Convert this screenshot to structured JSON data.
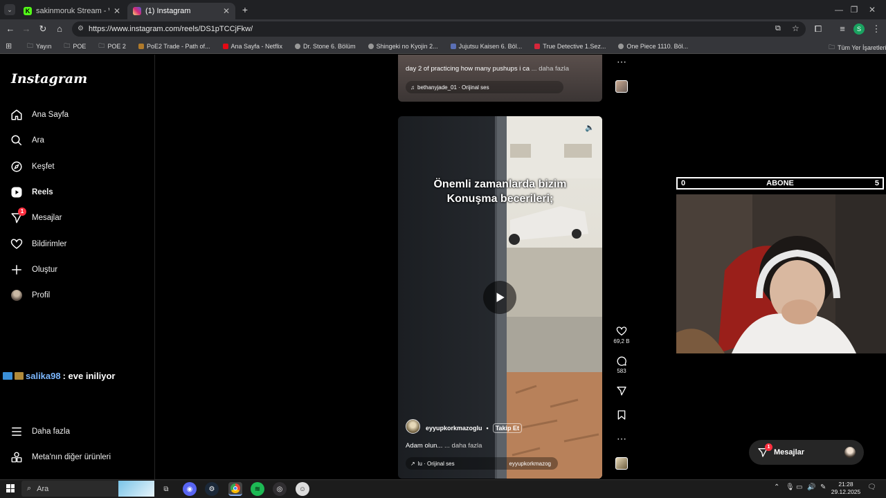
{
  "browser": {
    "tabs": [
      {
        "title": "sakinmoruk Stream - Watch Liv",
        "favicon_color": "#53fc18"
      },
      {
        "title": "(1) Instagram",
        "favicon_color": "#d62976"
      }
    ],
    "url": "https://www.instagram.com/reels/DS1pTCCjFkw/",
    "profile_initial": "S",
    "bookmarks": [
      {
        "label": "Yayın",
        "icon": "folder-icon"
      },
      {
        "label": "POE",
        "icon": "folder-icon"
      },
      {
        "label": "POE 2",
        "icon": "folder-icon"
      },
      {
        "label": "PoE2 Trade - Path of...",
        "icon": "poe-icon"
      },
      {
        "label": "Ana Sayfa - Netflix",
        "icon": "netflix-icon"
      },
      {
        "label": "Dr. Stone 6. Bölüm",
        "icon": "site-icon"
      },
      {
        "label": "Shingeki no Kyojin 2...",
        "icon": "site-icon"
      },
      {
        "label": "Jujutsu Kaisen 6. Böl...",
        "icon": "site-icon"
      },
      {
        "label": "True Detective 1.Sez...",
        "icon": "site-icon"
      },
      {
        "label": "One Piece 1110. Böl...",
        "icon": "site-icon"
      }
    ],
    "all_bookmarks": "Tüm Yer İşaretleri"
  },
  "instagram": {
    "logo": "Instagram",
    "nav": [
      {
        "label": "Ana Sayfa",
        "icon": "home-icon"
      },
      {
        "label": "Ara",
        "icon": "search-icon"
      },
      {
        "label": "Keşfet",
        "icon": "compass-icon"
      },
      {
        "label": "Reels",
        "icon": "reels-icon"
      },
      {
        "label": "Mesajlar",
        "icon": "messenger-icon",
        "badge": "1"
      },
      {
        "label": "Bildirimler",
        "icon": "heart-icon"
      },
      {
        "label": "Oluştur",
        "icon": "plus-icon"
      },
      {
        "label": "Profil",
        "icon": "avatar"
      }
    ],
    "more": "Daha fazla",
    "meta": "Meta'nın diğer ürünleri",
    "prev_reel": {
      "caption": "day 2 of practicing how many pushups i ca",
      "more": "... daha fazla",
      "audio": "bethanyjade_01 · Orijinal ses"
    },
    "reel": {
      "overlay_line1": "Önemli zamanlarda bizim",
      "overlay_line2": "Konuşma becerileri;",
      "username": "eyyupkorkmazoglu",
      "follow": "Takip Et",
      "caption": "Adam olun...",
      "more": "... daha fazla",
      "audio": "lu · Orijinal ses",
      "audio_owner": "eyyupkorkmazog",
      "likes": "69,2 B",
      "comments": "583"
    },
    "messages_pill": {
      "label": "Mesajlar",
      "badge": "1"
    }
  },
  "stream_overlay": {
    "abone_left": "0",
    "abone_label": "ABONE",
    "abone_right": "5",
    "chat_user": "salika98",
    "chat_text": ": eve iniliyor"
  },
  "taskbar": {
    "search": "Ara",
    "time": "21:28",
    "date": "29.12.2025"
  }
}
